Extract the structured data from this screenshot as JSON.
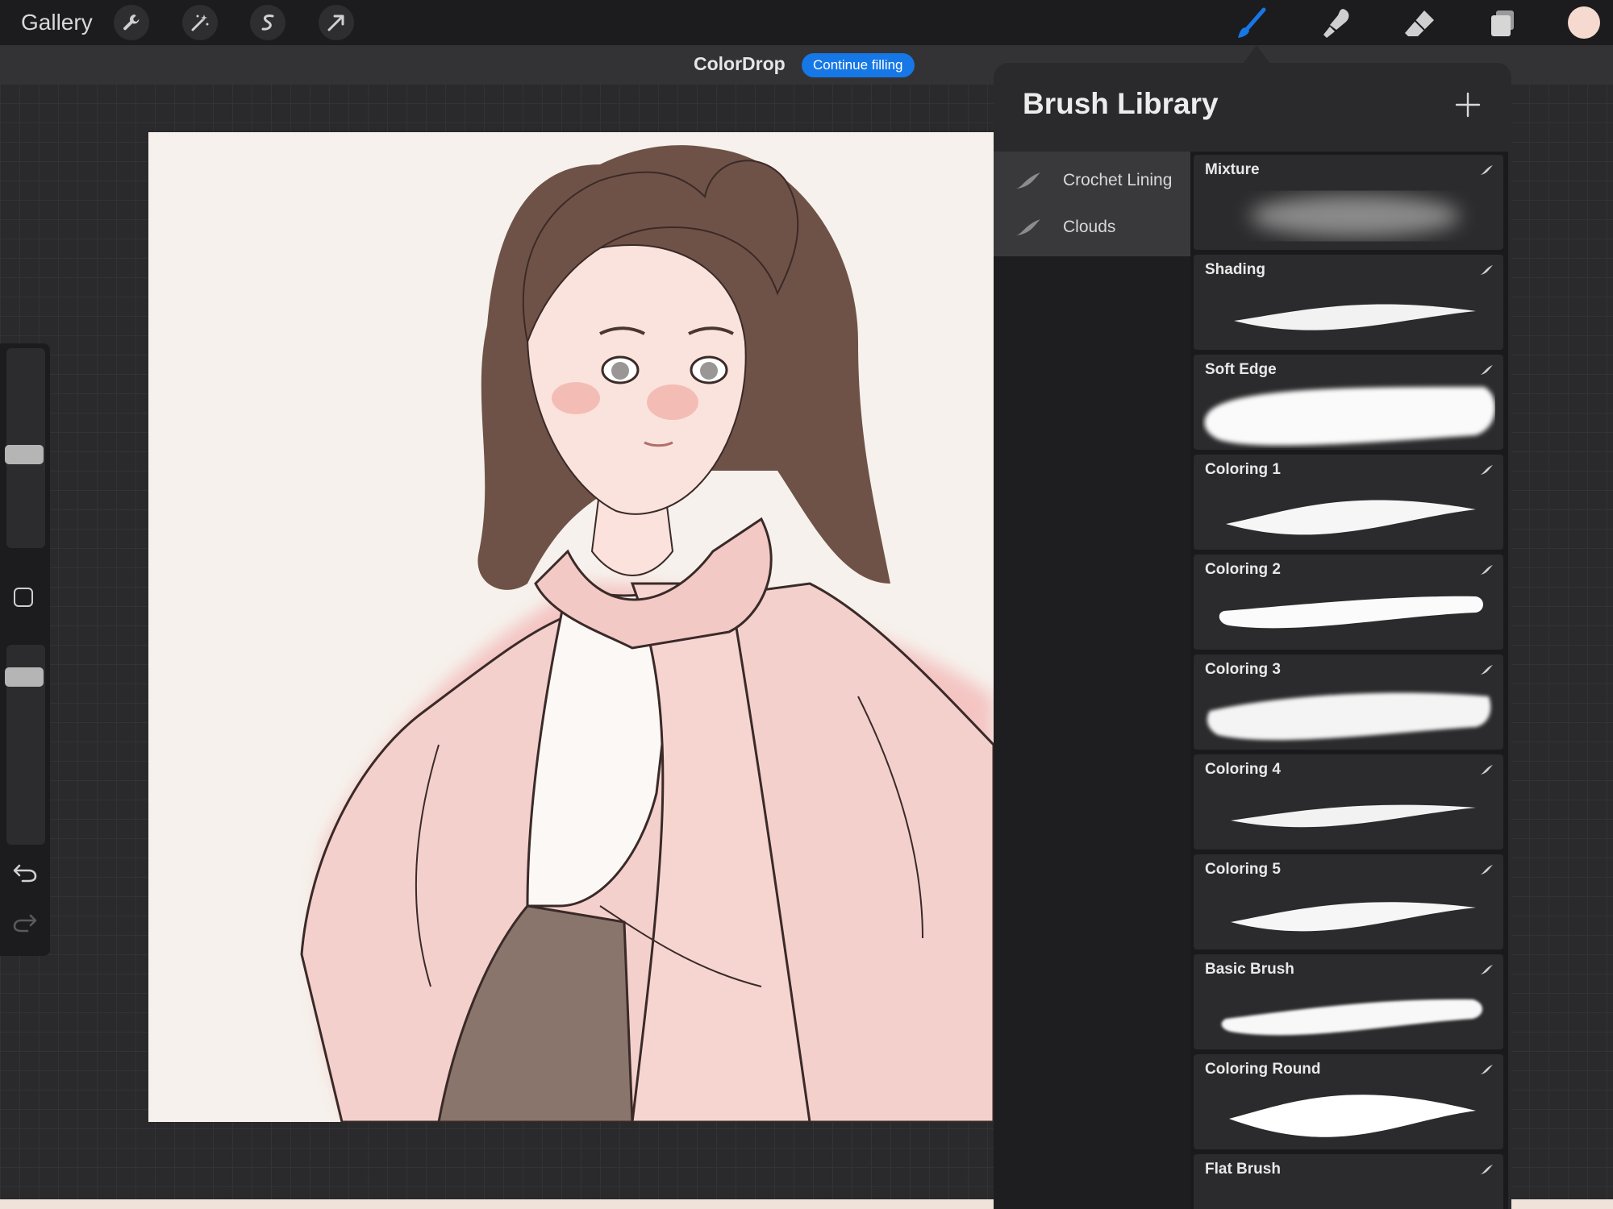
{
  "topbar": {
    "gallery_label": "Gallery",
    "left_tools": [
      "wrench-icon",
      "magic-wand-icon",
      "selection-icon",
      "transform-arrow-icon"
    ],
    "right_tools": [
      "brush-icon",
      "smudge-icon",
      "eraser-icon",
      "layers-icon"
    ],
    "active_tool": "brush-icon",
    "current_color": "#f6d9cf",
    "accent": "#1677e6"
  },
  "banner": {
    "title": "ColorDrop",
    "action_label": "Continue filling"
  },
  "sidebar": {
    "controls": [
      "brush-size-slider",
      "modifier-button",
      "opacity-slider",
      "undo-icon",
      "redo-icon"
    ]
  },
  "canvas": {
    "description_icon": "illustration-canvas"
  },
  "brush_library": {
    "title": "Brush Library",
    "add_icon": "plus-icon",
    "sets": [
      {
        "label": "Crochet Lining"
      },
      {
        "label": "Clouds"
      }
    ],
    "brushes": [
      {
        "label": "Mixture"
      },
      {
        "label": "Shading"
      },
      {
        "label": "Soft Edge"
      },
      {
        "label": "Coloring 1"
      },
      {
        "label": "Coloring 2"
      },
      {
        "label": "Coloring 3"
      },
      {
        "label": "Coloring 4"
      },
      {
        "label": "Coloring 5"
      },
      {
        "label": "Basic Brush"
      },
      {
        "label": "Coloring Round"
      },
      {
        "label": "Flat Brush"
      }
    ]
  }
}
